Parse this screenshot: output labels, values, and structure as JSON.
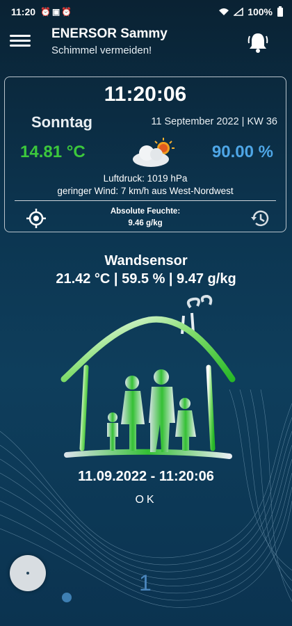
{
  "status_bar": {
    "time": "11:20",
    "battery": "100%",
    "left_icons": [
      "alarm-icon",
      "photo-icon",
      "alarm-icon"
    ],
    "right_icons": [
      "wifi-icon",
      "signal-icon",
      "battery-icon"
    ]
  },
  "app_bar": {
    "title": "ENERSOR Sammy",
    "subtitle": "Schimmel vermeiden!",
    "menu_icon": "menu-icon",
    "alarm_icon": "bell-icon"
  },
  "weather_card": {
    "time": "11:20:06",
    "day": "Sonntag",
    "date": "11 September 2022 | KW 36",
    "temperature": "14.81 °C",
    "humidity": "90.00 %",
    "weather_icon": "partly-cloudy-icon",
    "pressure": "Luftdruck: 1019 hPa",
    "wind": "geringer Wind: 7 km/h aus West-Nordwest",
    "abs_humidity_label": "Absolute Feuchte:",
    "abs_humidity_value": "9.46 g/kg"
  },
  "sensor": {
    "title": "Wandsensor",
    "values": "21.42 °C  |  59.5 %  |  9.47 g/kg",
    "timestamp": "11.09.2022 - 11:20:06",
    "status": "OK"
  },
  "pager": {
    "page": "1"
  },
  "colors": {
    "temp": "#3cc83c",
    "humidity": "#4ea6e6",
    "accent": "#4a86bd",
    "background": "#0c3550"
  }
}
